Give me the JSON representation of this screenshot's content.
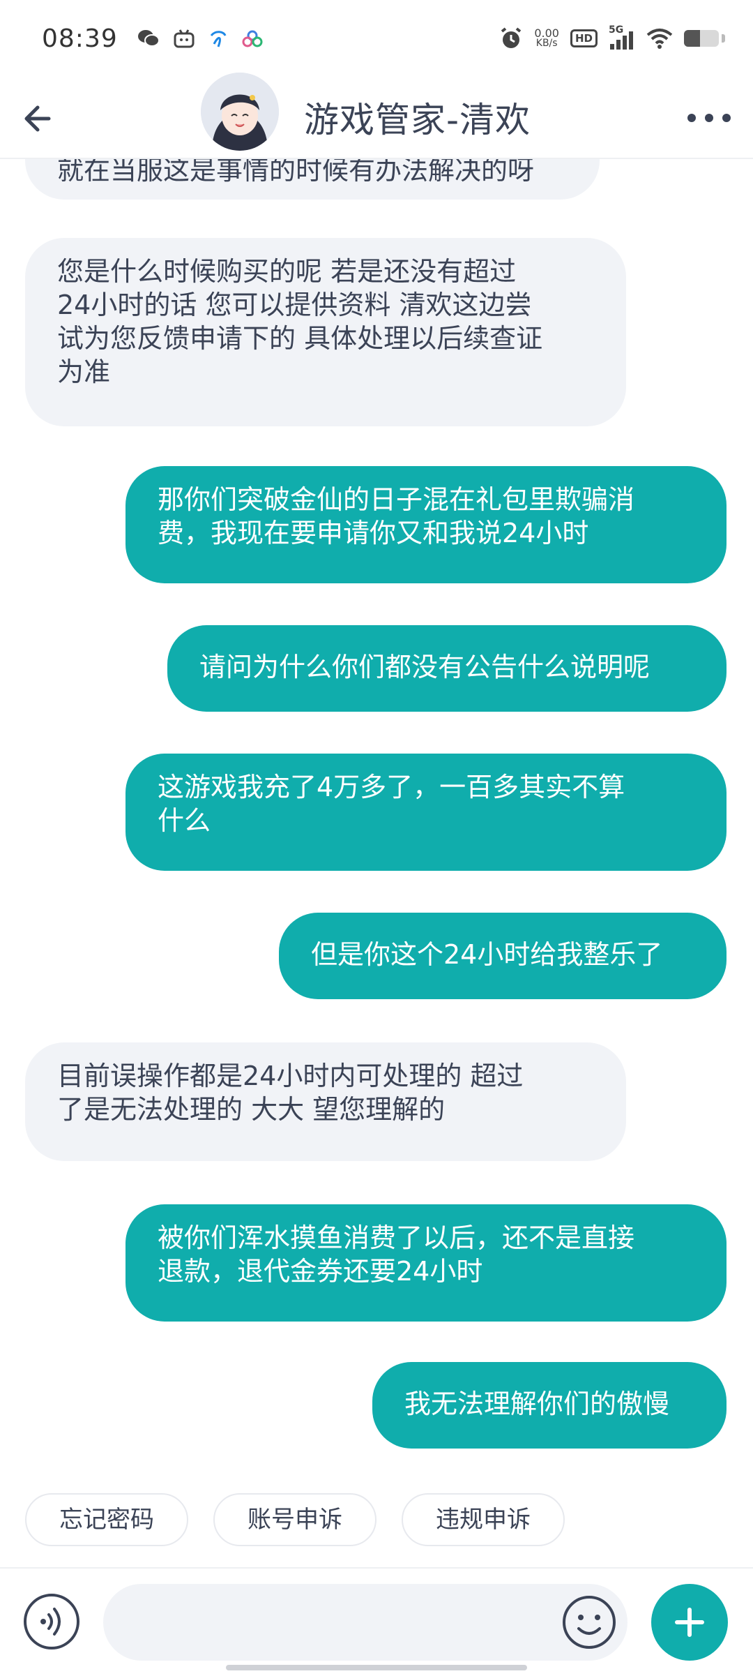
{
  "status_bar": {
    "time": "08:39",
    "net_speed_value": "0.00",
    "net_speed_unit": "KB/s",
    "hd_label": "HD",
    "network_label": "5G",
    "battery_level": 0.45,
    "app_icons": [
      "wechat-icon",
      "bilibili-icon",
      "telecom-icon",
      "cloud-icon"
    ]
  },
  "header": {
    "title": "游戏管家-清欢"
  },
  "messages": [
    {
      "side": "in",
      "text": "就在当服这是事情的时候有办法解决的呀"
    },
    {
      "side": "in",
      "text": "您是什么时候购买的呢 若是还没有超过\n24小时的话 您可以提供资料 清欢这边尝\n试为您反馈申请下的 具体处理以后续查证\n为准"
    },
    {
      "side": "out",
      "text": "那你们突破金仙的日子混在礼包里欺骗消\n费，我现在要申请你又和我说24小时"
    },
    {
      "side": "out",
      "text": "请问为什么你们都没有公告什么说明呢"
    },
    {
      "side": "out",
      "text": "这游戏我充了4万多了，一百多其实不算\n什么"
    },
    {
      "side": "out",
      "text": "但是你这个24小时给我整乐了"
    },
    {
      "side": "in",
      "text": "目前误操作都是24小时内可处理的 超过\n了是无法处理的 大大 望您理解的"
    },
    {
      "side": "out",
      "text": "被你们浑水摸鱼消费了以后，还不是直接\n退款，退代金券还要24小时"
    },
    {
      "side": "out",
      "text": "我无法理解你们的傲慢"
    }
  ],
  "quick_replies": [
    "忘记密码",
    "账号申诉",
    "违规申诉"
  ],
  "input": {
    "value": "",
    "placeholder": ""
  },
  "colors": {
    "accent": "#10adac",
    "incoming_bubble": "#f1f3f7",
    "text": "#3b4356"
  }
}
